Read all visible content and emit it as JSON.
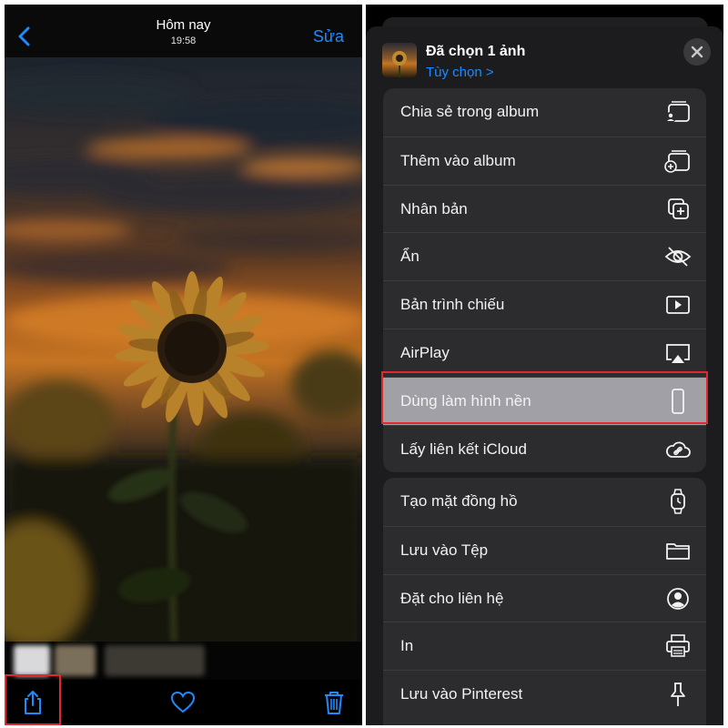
{
  "left": {
    "header": {
      "title": "Hôm nay",
      "time": "19:58",
      "edit_label": "Sửa"
    },
    "toolbar": {
      "icons": [
        "share-icon",
        "heart-icon",
        "trash-icon"
      ]
    },
    "colors": {
      "accent": "#1d8bff",
      "highlight": "#e0282e"
    }
  },
  "sheet": {
    "title": "Đã chọn 1 ảnh",
    "options_label": "Tùy chọn >",
    "group1": [
      {
        "label": "Chia sẻ trong album",
        "icon": "shared-album-icon"
      },
      {
        "label": "Thêm vào album",
        "icon": "add-to-album-icon"
      },
      {
        "label": "Nhân bản",
        "icon": "duplicate-icon"
      },
      {
        "label": "Ẩn",
        "icon": "hide-eye-icon"
      },
      {
        "label": "Bản trình chiếu",
        "icon": "slideshow-icon"
      },
      {
        "label": "AirPlay",
        "icon": "airplay-icon"
      },
      {
        "label": "Dùng làm hình nền",
        "icon": "phone-wallpaper-icon",
        "highlighted": true
      },
      {
        "label": "Lấy liên kết iCloud",
        "icon": "icloud-link-icon"
      }
    ],
    "group2": [
      {
        "label": "Tạo mặt đồng hồ",
        "icon": "watch-icon"
      },
      {
        "label": "Lưu vào Tệp",
        "icon": "folder-icon"
      },
      {
        "label": "Đặt cho liên hệ",
        "icon": "contact-icon"
      },
      {
        "label": "In",
        "icon": "printer-icon"
      },
      {
        "label": "Lưu vào Pinterest",
        "icon": "pin-icon"
      }
    ]
  }
}
